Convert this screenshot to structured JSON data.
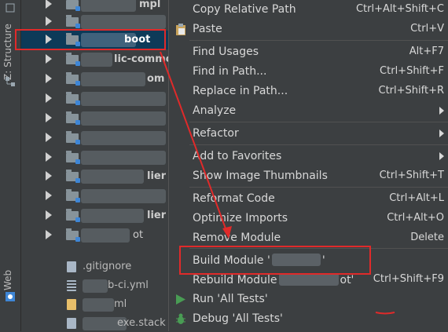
{
  "tool_strip": {
    "structure_label": "Z: Structure",
    "web_label": "Web"
  },
  "tree": {
    "rows": [
      {
        "name": "mpl"
      },
      {
        "name": "boot"
      },
      {
        "name": "lic-common"
      },
      {
        "name": "om"
      },
      {
        "name": ""
      },
      {
        "name": ""
      },
      {
        "name": ""
      },
      {
        "name": ""
      },
      {
        "name": "lier"
      },
      {
        "name": ""
      },
      {
        "name": "lier"
      },
      {
        "name": ""
      },
      {
        "name": "ot"
      }
    ],
    "files": [
      {
        "name": ".gitignore",
        "icon": "file-icon"
      },
      {
        "name": "b-ci.yml",
        "icon": "yml-file-icon"
      },
      {
        "name": "ml",
        "icon": "xml-file-icon"
      },
      {
        "name": "exe.stack",
        "icon": "file-icon"
      }
    ]
  },
  "menu": {
    "items": [
      {
        "label": "Copy Relative Path",
        "shortcut": "Ctrl+Alt+Shift+C"
      },
      {
        "label": "Paste",
        "shortcut": "Ctrl+V",
        "icon": "clipboard-icon"
      },
      {
        "label": "Find Usages",
        "shortcut": "Alt+F7"
      },
      {
        "label": "Find in Path...",
        "shortcut": "Ctrl+Shift+F"
      },
      {
        "label": "Replace in Path...",
        "shortcut": "Ctrl+Shift+R"
      },
      {
        "label": "Analyze",
        "submenu": true
      },
      {
        "label": "Refactor",
        "submenu": true
      },
      {
        "label": "Add to Favorites",
        "submenu": true
      },
      {
        "label": "Show Image Thumbnails",
        "shortcut": "Ctrl+Shift+T"
      },
      {
        "label": "Reformat Code",
        "shortcut": "Ctrl+Alt+L"
      },
      {
        "label": "Optimize Imports",
        "shortcut": "Ctrl+Alt+O"
      },
      {
        "label": "Remove Module",
        "shortcut": "Delete"
      },
      {
        "label_prefix": "Build Module '",
        "label_suffix": "'"
      },
      {
        "label_prefix": "Rebuild Module",
        "label_suffix": "ot'",
        "shortcut": "Ctrl+Shift+F9"
      },
      {
        "label": "Run 'All Tests'",
        "icon": "run-icon"
      },
      {
        "label": "Debug 'All Tests'",
        "icon": "debug-icon"
      }
    ]
  },
  "colors": {
    "background": "#3c3f41",
    "selection": "#0d3a58",
    "annotation_red": "#e02a2a",
    "run_green": "#499c54"
  }
}
